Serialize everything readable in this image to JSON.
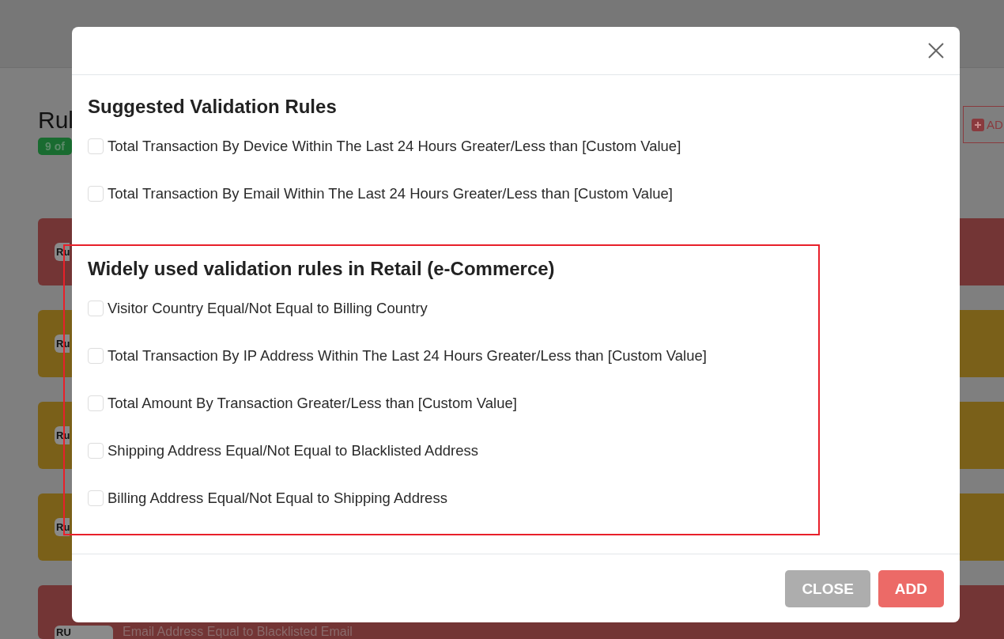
{
  "page": {
    "title": "Rul",
    "count_badge": "9 of",
    "add_button": "AD"
  },
  "rules": [
    {
      "color": "#733535",
      "tag": "Ru"
    },
    {
      "color": "#7a6019",
      "tag": "Ru"
    },
    {
      "color": "#7a6019",
      "tag": "Ru"
    },
    {
      "color": "#7a6019",
      "tag": "Ru"
    },
    {
      "color": "#733535",
      "tag": "RU",
      "name": "Email Address Equal to Blacklisted Email"
    }
  ],
  "dialog": {
    "sections": [
      {
        "title": "Suggested Validation Rules",
        "highlighted": false,
        "items": [
          {
            "label": "Total Transaction By Device Within The Last 24 Hours Greater/Less than [Custom Value]",
            "checked": false
          },
          {
            "label": "Total Transaction By Email Within The Last 24 Hours Greater/Less than [Custom Value]",
            "checked": false
          }
        ]
      },
      {
        "title": "Widely used validation rules in Retail (e-Commerce)",
        "highlighted": true,
        "items": [
          {
            "label": "Visitor Country Equal/Not Equal to Billing Country",
            "checked": false
          },
          {
            "label": "Total Transaction By IP Address Within The Last 24 Hours Greater/Less than [Custom Value]",
            "checked": false
          },
          {
            "label": "Total Amount By Transaction Greater/Less than [Custom Value]",
            "checked": false
          },
          {
            "label": "Shipping Address Equal/Not Equal to Blacklisted Address",
            "checked": false
          },
          {
            "label": "Billing Address Equal/Not Equal to Shipping Address",
            "checked": false
          }
        ]
      }
    ],
    "buttons": [
      {
        "label": "CLOSE",
        "kind": "secondary"
      },
      {
        "label": "ADD",
        "kind": "primary"
      }
    ]
  }
}
